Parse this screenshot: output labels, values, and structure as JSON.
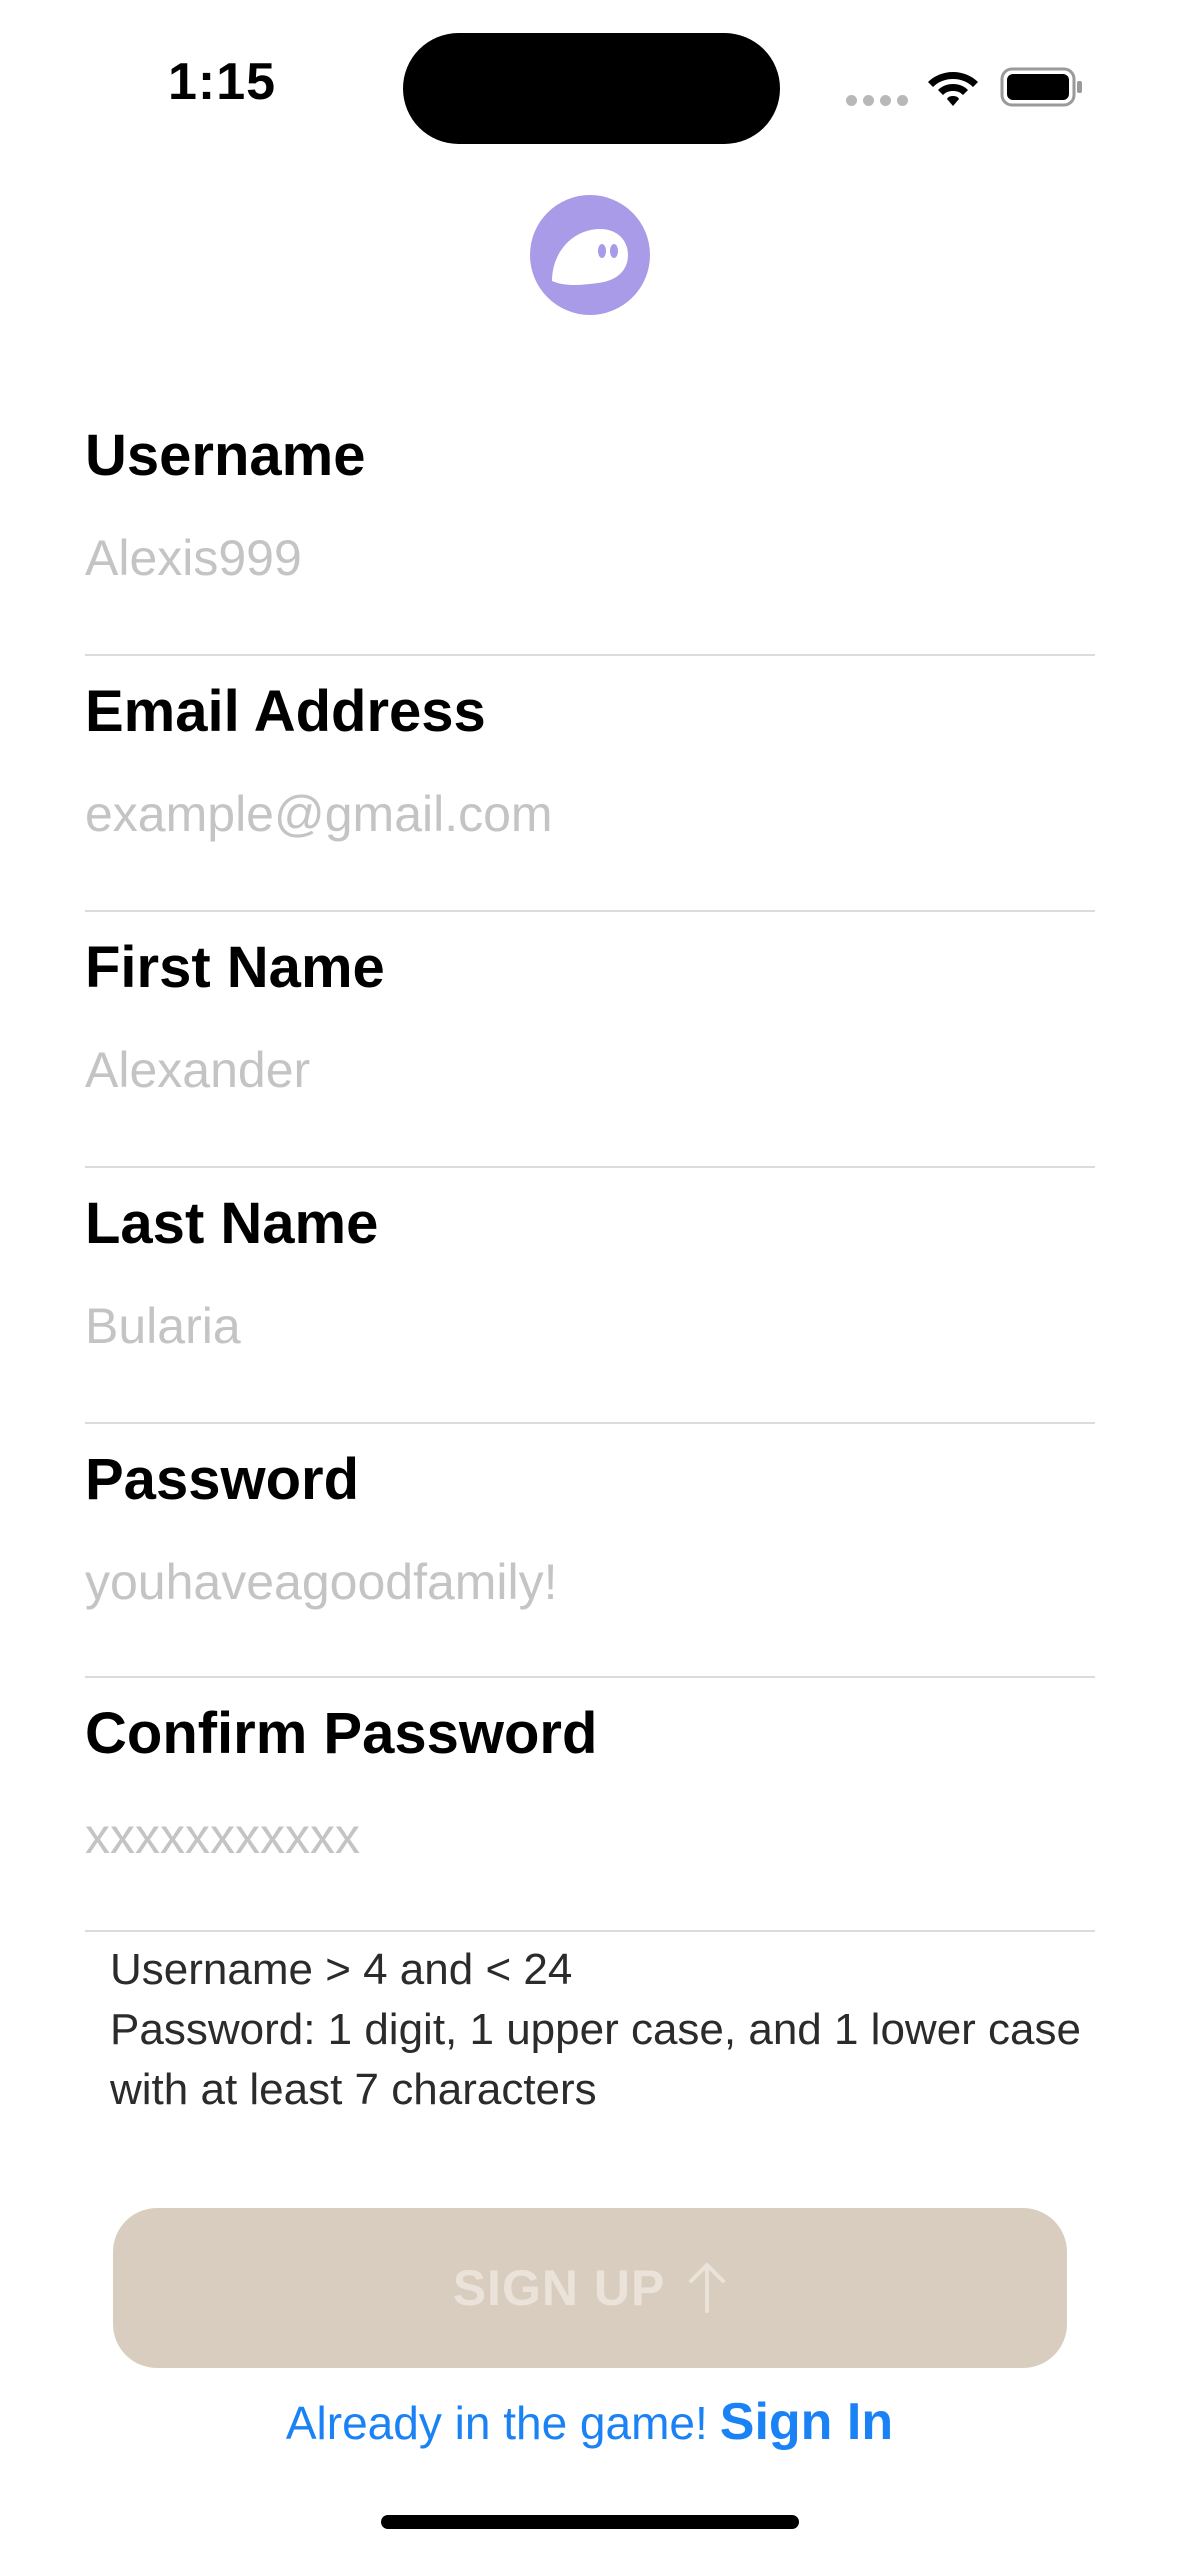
{
  "status_bar": {
    "time": "1:15",
    "wifi_icon": "wifi-icon",
    "battery_icon": "battery-icon",
    "signal_icon": "cellular-dots-icon"
  },
  "logo": {
    "icon": "ghost-logo-icon",
    "color": "#a99be7"
  },
  "form": {
    "fields": [
      {
        "label": "Username",
        "placeholder": "Alexis999"
      },
      {
        "label": "Email Address",
        "placeholder": "example@gmail.com"
      },
      {
        "label": "First Name",
        "placeholder": "Alexander"
      },
      {
        "label": "Last Name",
        "placeholder": "Bularia"
      },
      {
        "label": "Password",
        "placeholder": "youhaveagoodfamily!"
      },
      {
        "label": "Confirm Password",
        "placeholder": "xxxxxxxxxxx"
      }
    ]
  },
  "requirements": {
    "line1": "Username > 4 and < 24",
    "line2": "Password: 1 digit, 1 upper case, and 1 lower case",
    "line3": "with at least 7 characters"
  },
  "signup_button": {
    "label": "SIGN UP",
    "icon": "arrow-up-icon",
    "color": "#d9cdbf"
  },
  "signin": {
    "prompt": "Already in the game!",
    "link": "Sign In",
    "color": "#1a82f5"
  }
}
